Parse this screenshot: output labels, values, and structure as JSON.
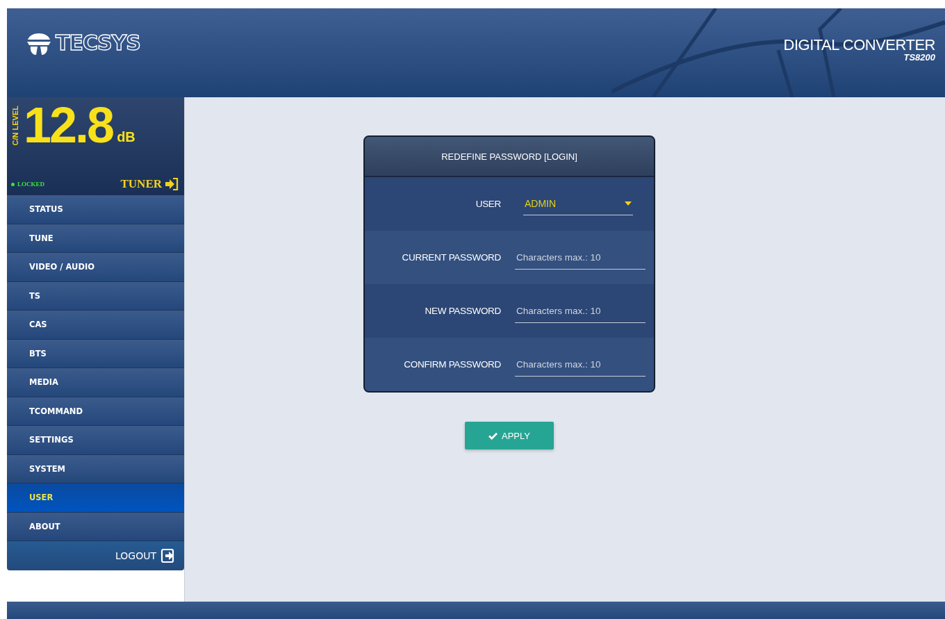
{
  "header": {
    "logo": "**TEC**SYS",
    "title": "DIGITAL CONVERTER",
    "model": "TS8200"
  },
  "meter": {
    "label": "C/N LEVEL",
    "value": "12.8",
    "unit": "dB",
    "status": "LOCKED",
    "locked": true,
    "tuner": "TUNER"
  },
  "sidebar": {
    "items": [
      {
        "label": "STATUS",
        "selected": false
      },
      {
        "label": "TUNE",
        "selected": false
      },
      {
        "label": "VIDEO / AUDIO",
        "selected": false
      },
      {
        "label": "TS",
        "selected": false
      },
      {
        "label": "CAS",
        "selected": false
      },
      {
        "label": "BTS",
        "selected": false
      },
      {
        "label": "MEDIA",
        "selected": false
      },
      {
        "label": "TCOMMAND",
        "selected": false
      },
      {
        "label": "SETTINGS",
        "selected": false
      },
      {
        "label": "SYSTEM",
        "selected": false
      },
      {
        "label": "USER",
        "selected": true
      },
      {
        "label": "ABOUT",
        "selected": false
      }
    ],
    "logout": "LOGOUT"
  },
  "form": {
    "title": "REDEFINE PASSWORD [LOGIN]",
    "fields": [
      {
        "kind": "select",
        "label": "USER",
        "value": "ADMIN"
      },
      {
        "kind": "password",
        "label": "CURRENT PASSWORD",
        "placeholder": "Characters max.: 10"
      },
      {
        "kind": "password",
        "label": "NEW PASSWORD",
        "placeholder": "Characters max.: 10"
      },
      {
        "kind": "password",
        "label": "CONFIRM PASSWORD",
        "placeholder": "Characters max.: 10"
      }
    ]
  },
  "apply": "APPLY"
}
